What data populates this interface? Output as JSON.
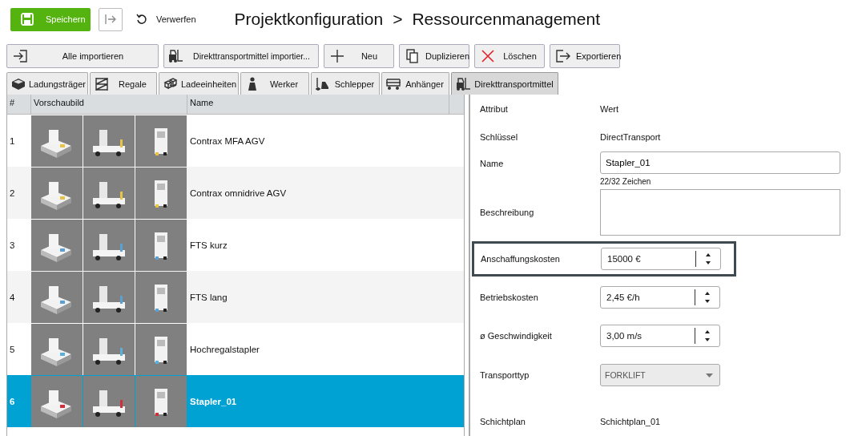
{
  "header": {
    "save_button": "Speichern",
    "discard_button": "Verwerfen",
    "title": "Projektkonfiguration",
    "separator": ">",
    "subtitle": "Ressourcenmanagement"
  },
  "toolbar": [
    "Alle importieren",
    "Direkttransportmittel importier...",
    "Neu",
    "Duplizieren",
    "Löschen",
    "Exportieren"
  ],
  "tabs": [
    {
      "label": "Ladungsträger",
      "selected": false
    },
    {
      "label": "Regale",
      "selected": false
    },
    {
      "label": "Ladeeinheiten",
      "selected": false
    },
    {
      "label": "Werker",
      "selected": false
    },
    {
      "label": "Schlepper",
      "selected": false
    },
    {
      "label": "Anhänger",
      "selected": false
    },
    {
      "label": "Direkttransportmittel",
      "selected": true
    }
  ],
  "table": {
    "columns": [
      "#",
      "Vorschaubild",
      "Name"
    ],
    "rows": [
      {
        "number": "1",
        "name": "Contrax MFA AGV",
        "selected": false
      },
      {
        "number": "2",
        "name": "Contrax omnidrive AGV",
        "selected": false
      },
      {
        "number": "3",
        "name": "FTS kurz",
        "selected": false
      },
      {
        "number": "4",
        "name": "FTS lang",
        "selected": false
      },
      {
        "number": "5",
        "name": "Hochregalstapler",
        "selected": false
      },
      {
        "number": "6",
        "name": "Stapler_01",
        "selected": true
      }
    ]
  },
  "properties": {
    "columns": [
      "Attribut",
      "Wert"
    ],
    "items": [
      {
        "kind": "text",
        "label": "Schlüssel",
        "value": "DirectTransport"
      },
      {
        "kind": "field",
        "label": "Name",
        "value": "Stapler_01",
        "counter": "22/32 Zeichen"
      },
      {
        "kind": "textarea",
        "label": "Beschreibung"
      },
      {
        "kind": "spinner",
        "label": "Anschaffungskosten",
        "value": "15000 €",
        "highlighted": true
      },
      {
        "kind": "spinner",
        "label": "Betriebskosten",
        "value": "2,45 €/h",
        "highlighted": false
      },
      {
        "kind": "spinner",
        "label": "ø Geschwindigkeit",
        "value": "3,00 m/s",
        "highlighted": false
      },
      {
        "kind": "dropdown",
        "label": "Transporttyp",
        "value": "FORKLIFT",
        "disabled": true
      },
      {
        "kind": "text",
        "label": "Schichtplan",
        "value": "Schichtplan_01"
      }
    ]
  }
}
